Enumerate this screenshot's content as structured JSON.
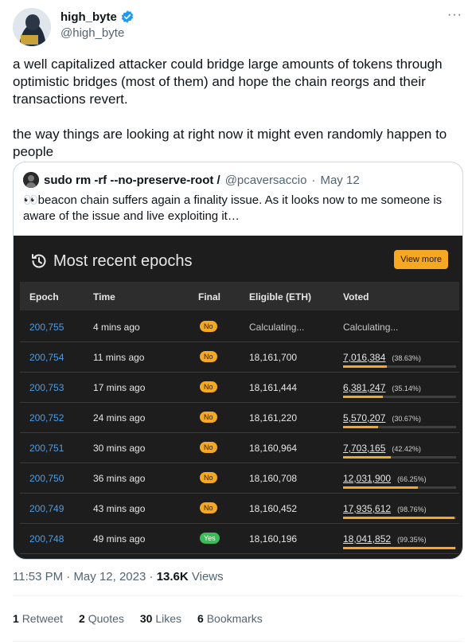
{
  "author": {
    "display_name": "high_byte",
    "handle": "@high_byte",
    "more_label": "···"
  },
  "tweet": {
    "text": "a well capitalized attacker could bridge large amounts of tokens through optimistic bridges (most of them) and hope the chain reorgs and their transactions revert.\n\nthe way things are looking at right now it might even randomly happen to people"
  },
  "quote": {
    "display_name": "sudo rm -rf --no-preserve-root /",
    "handle": "@pcaversaccio",
    "separator": "·",
    "date": "May 12",
    "text": "👀beacon chain suffers again a finality issue. As it looks now to me someone is aware of the issue and live exploiting it…",
    "panel": {
      "title": "Most recent epochs",
      "view_more": "View more",
      "headers": {
        "epoch": "Epoch",
        "time": "Time",
        "final": "Final",
        "eligible": "Eligible (ETH)",
        "voted": "Voted"
      },
      "rows": [
        {
          "epoch": "200,755",
          "time": "4 mins ago",
          "final": "No",
          "eligible": "Calculating...",
          "voted": "Calculating...",
          "pct": "",
          "fill": 0
        },
        {
          "epoch": "200,754",
          "time": "11 mins ago",
          "final": "No",
          "eligible": "18,161,700",
          "voted": "7,016,384",
          "pct": "(38.63%)",
          "fill": 0.3863
        },
        {
          "epoch": "200,753",
          "time": "17 mins ago",
          "final": "No",
          "eligible": "18,161,444",
          "voted": "6,381,247",
          "pct": "(35.14%)",
          "fill": 0.3514
        },
        {
          "epoch": "200,752",
          "time": "24 mins ago",
          "final": "No",
          "eligible": "18,161,220",
          "voted": "5,570,207",
          "pct": "(30.67%)",
          "fill": 0.3067
        },
        {
          "epoch": "200,751",
          "time": "30 mins ago",
          "final": "No",
          "eligible": "18,160,964",
          "voted": "7,703,165",
          "pct": "(42.42%)",
          "fill": 0.4242
        },
        {
          "epoch": "200,750",
          "time": "36 mins ago",
          "final": "No",
          "eligible": "18,160,708",
          "voted": "12,031,900",
          "pct": "(66.25%)",
          "fill": 0.6625
        },
        {
          "epoch": "200,749",
          "time": "43 mins ago",
          "final": "No",
          "eligible": "18,160,452",
          "voted": "17,935,612",
          "pct": "(98.76%)",
          "fill": 0.9876
        },
        {
          "epoch": "200,748",
          "time": "49 mins ago",
          "final": "Yes",
          "eligible": "18,160,196",
          "voted": "18,041,852",
          "pct": "(99.35%)",
          "fill": 0.9935
        }
      ]
    }
  },
  "meta": {
    "time": "11:53 PM",
    "separator": "·",
    "date": "May 12, 2023",
    "views_count": "13.6K",
    "views_label": "Views"
  },
  "stats": {
    "retweets_count": "1",
    "retweets_label": "Retweet",
    "quotes_count": "2",
    "quotes_label": "Quotes",
    "likes_count": "30",
    "likes_label": "Likes",
    "bookmarks_count": "6",
    "bookmarks_label": "Bookmarks"
  },
  "colors": {
    "accent": "#f7a823",
    "link": "#4e9de6",
    "verified": "#1d9bf0",
    "panel_bg": "#1d1d1d",
    "yes": "#3dbb5a"
  }
}
